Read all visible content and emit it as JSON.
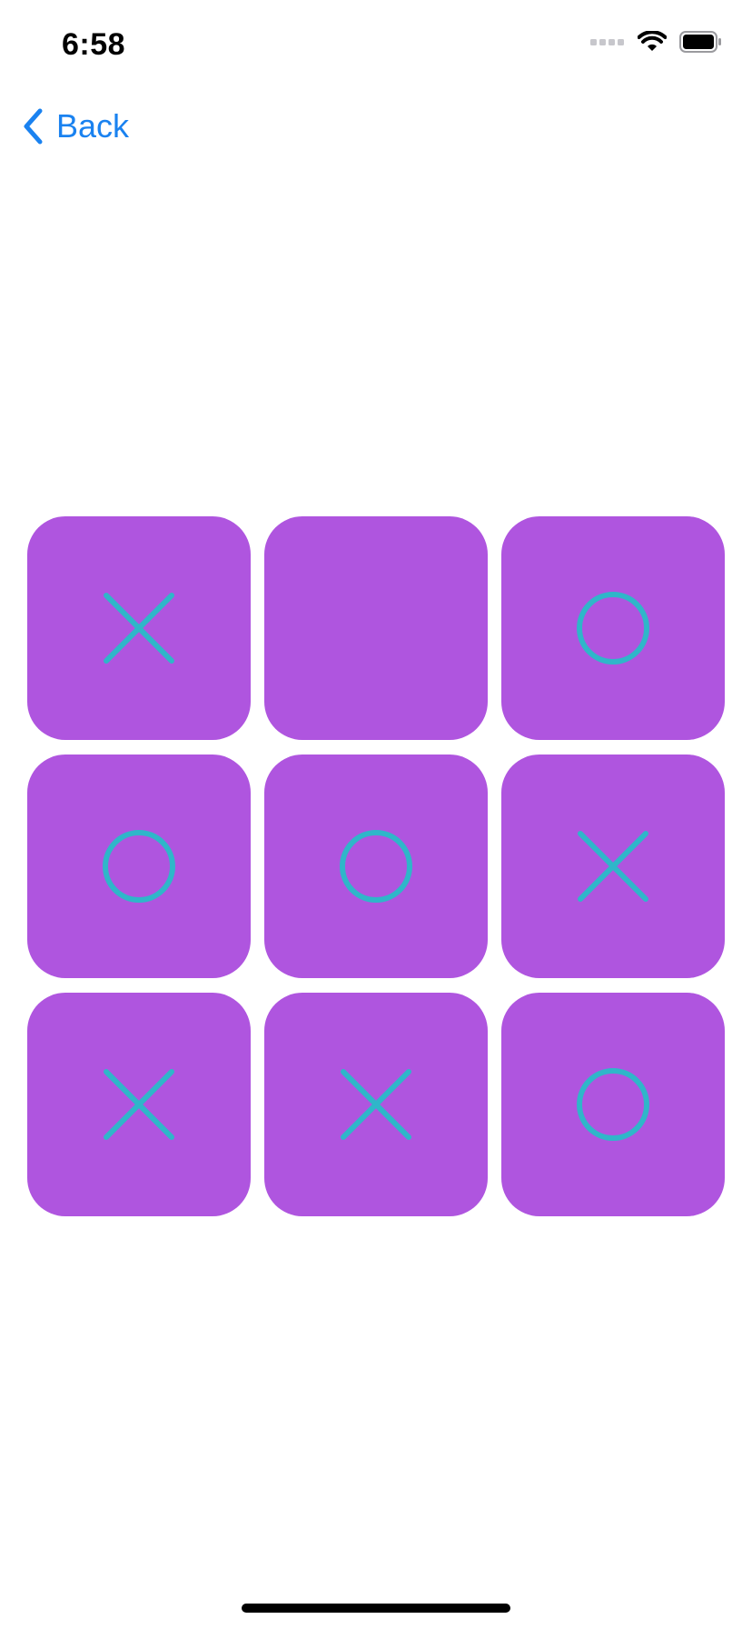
{
  "status_bar": {
    "time": "6:58",
    "icons": [
      "signal-dots-icon",
      "wifi-icon",
      "battery-icon"
    ]
  },
  "nav": {
    "back_label": "Back",
    "back_icon": "chevron-left-icon"
  },
  "board": {
    "cells": [
      "X",
      "",
      "O",
      "O",
      "O",
      "X",
      "X",
      "X",
      "O"
    ]
  },
  "colors": {
    "cell_background": "#af55df",
    "mark_color": "#2fb6c9",
    "accent_blue": "#1a82f0"
  }
}
